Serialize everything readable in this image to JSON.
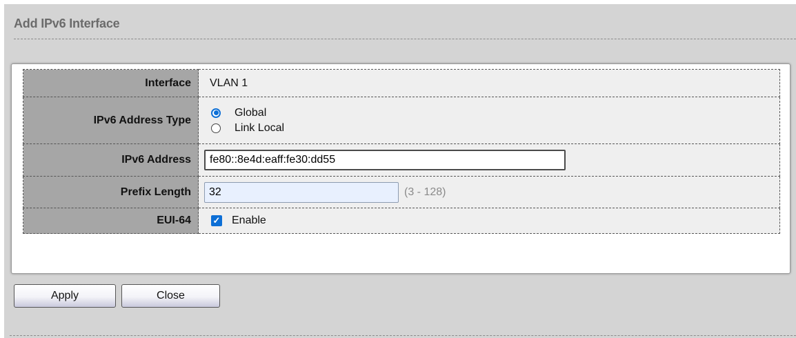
{
  "dialog": {
    "title": "Add IPv6 Interface"
  },
  "form": {
    "interface": {
      "label": "Interface",
      "value": "VLAN 1"
    },
    "address_type": {
      "label": "IPv6 Address Type",
      "options": [
        {
          "label": "Global",
          "selected": true
        },
        {
          "label": "Link Local",
          "selected": false
        }
      ]
    },
    "ipv6_address": {
      "label": "IPv6 Address",
      "value": "fe80::8e4d:eaff:fe30:dd55"
    },
    "prefix_length": {
      "label": "Prefix Length",
      "value": "32",
      "hint": "(3 - 128)"
    },
    "eui64": {
      "label": "EUI-64",
      "checkbox_label": "Enable",
      "checked": true
    }
  },
  "buttons": {
    "apply": "Apply",
    "close": "Close"
  },
  "colors": {
    "accent": "#0d6fd6",
    "label_cell": "#a6a6a6",
    "value_cell": "#efefef",
    "panel": "#d4d4d4"
  },
  "icons": {
    "radio_selected": "radio-selected-icon",
    "radio_unselected": "radio-unselected-icon",
    "checkbox_checked": "checkbox-checked-icon"
  }
}
